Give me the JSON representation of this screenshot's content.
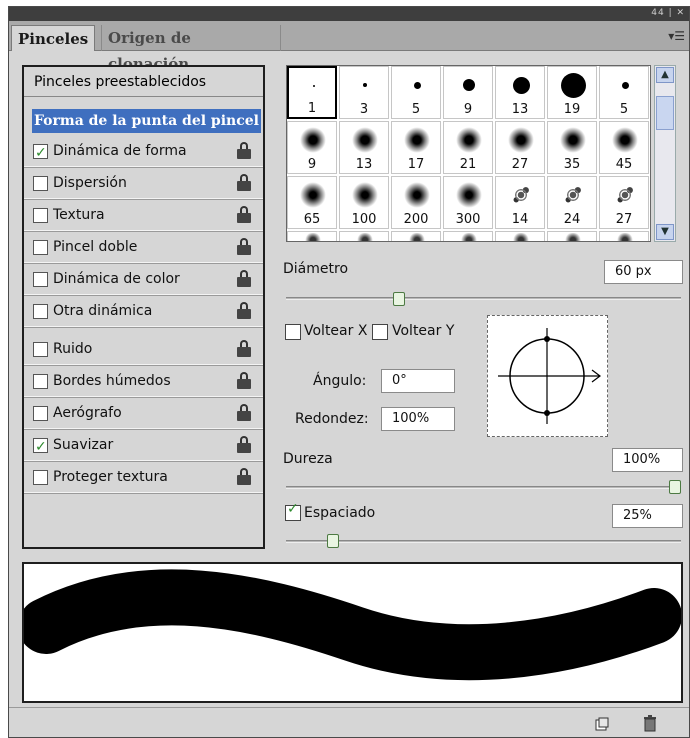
{
  "panel": {
    "tab_active": "Pinceles",
    "tab_inactive": "Origen de clonación",
    "window_controls": "44 | ✕",
    "menu_icon": "panel-menu-icon"
  },
  "sidebar": {
    "preset_header": "Pinceles preestablecidos",
    "tip_header": "Forma de la punta del pincel",
    "items": [
      {
        "label": "Dinámica de forma",
        "checked": true
      },
      {
        "label": "Dispersión",
        "checked": false
      },
      {
        "label": "Textura",
        "checked": false
      },
      {
        "label": "Pincel doble",
        "checked": false
      },
      {
        "label": "Dinámica de color",
        "checked": false
      },
      {
        "label": "Otra dinámica",
        "checked": false
      },
      {
        "label": "Ruido",
        "checked": false
      },
      {
        "label": "Bordes húmedos",
        "checked": false
      },
      {
        "label": "Aerógrafo",
        "checked": false
      },
      {
        "label": "Suavizar",
        "checked": true
      },
      {
        "label": "Proteger textura",
        "checked": false
      }
    ]
  },
  "brushes": {
    "sizes": [
      "1",
      "3",
      "5",
      "9",
      "13",
      "19",
      "5",
      "9",
      "13",
      "17",
      "21",
      "27",
      "35",
      "45",
      "65",
      "100",
      "200",
      "300",
      "14",
      "24",
      "27"
    ],
    "selected": "1"
  },
  "settings": {
    "diameter_label": "Diámetro",
    "diameter_value": "60 px",
    "diameter_slider": 0.29,
    "flip_x_label": "Voltear X",
    "flip_y_label": "Voltear Y",
    "angle_label": "Ángulo:",
    "angle_value": "0°",
    "roundness_label": "Redondez:",
    "roundness_value": "100%",
    "hardness_label": "Dureza",
    "hardness_value": "100%",
    "hardness_slider": 1.0,
    "spacing_label": "Espaciado",
    "spacing_checked": true,
    "spacing_value": "25%",
    "spacing_slider": 0.12
  },
  "colors": {
    "selection": "#3f6fbf",
    "checkmark": "#2d8a2d"
  }
}
